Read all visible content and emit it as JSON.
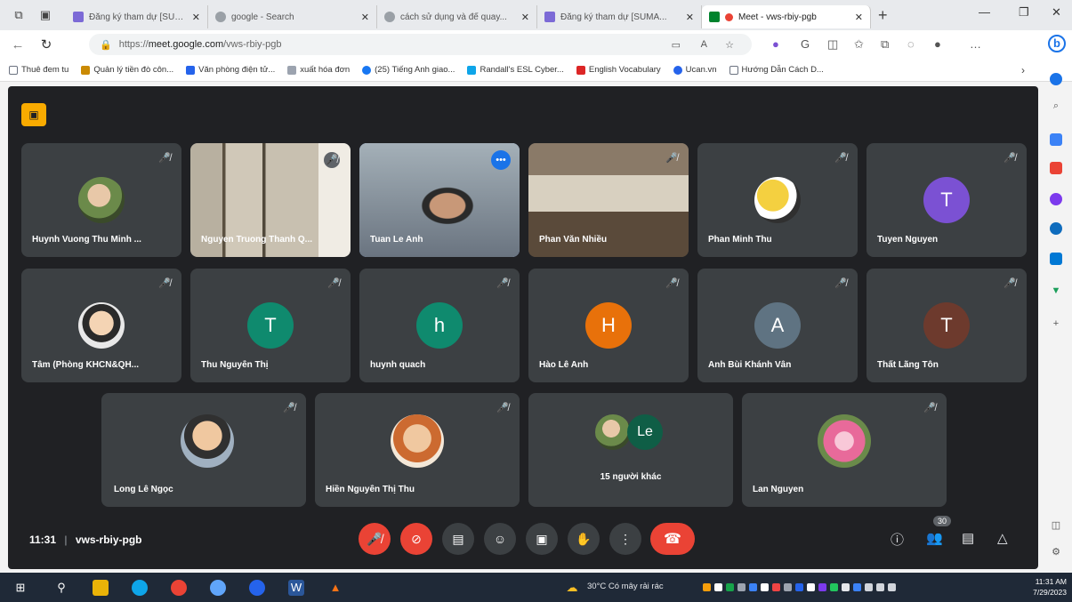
{
  "browser": {
    "tabs": [
      {
        "label": "Đăng ký tham dự [SUMA...",
        "color": "#7c6ad6"
      },
      {
        "label": "google - Search",
        "color": "#9aa0a6"
      },
      {
        "label": "cách sử dụng và để quay...",
        "color": "#9aa0a6"
      },
      {
        "label": "Đăng ký tham dự [SUMA...",
        "color": "#7c6ad6"
      },
      {
        "label": "Meet - vws-rbiy-pgb",
        "color": "#00832d"
      }
    ],
    "url_prefix": "https://",
    "url_host": "meet.google.com",
    "url_path": "/vws-rbiy-pgb",
    "bookmarks": [
      {
        "label": "Thuê đem tu",
        "color": "#6b7280"
      },
      {
        "label": "Quản lý tiền đò côn...",
        "color": "#ca8a04"
      },
      {
        "label": "Văn phòng điện tử...",
        "color": "#2563eb"
      },
      {
        "label": "xuất hóa đơn",
        "color": "#6b7280"
      },
      {
        "label": "(25) Tiếng Anh giao...",
        "color": "#1877f2"
      },
      {
        "label": "Randall's ESL Cyber...",
        "color": "#0ea5e9"
      },
      {
        "label": "English Vocabulary",
        "color": "#dc2626"
      },
      {
        "label": "Ucan.vn",
        "color": "#2563eb"
      },
      {
        "label": "Hướng Dẫn Cách D...",
        "color": "#6b7280"
      }
    ]
  },
  "meet": {
    "time": "11:31",
    "separator": "|",
    "code": "vws-rbiy-pgb",
    "participant_count": "30",
    "participants": [
      {
        "name": "Huynh Vuong Thu Minh ...",
        "avatar": "photo"
      },
      {
        "name": "Nguyen Truong Thanh Q...",
        "avatar": "video"
      },
      {
        "name": "Tuan Le Anh",
        "avatar": "video"
      },
      {
        "name": "Phan Văn Nhiều",
        "avatar": "video"
      },
      {
        "name": "Phan Minh Thu",
        "avatar": "photo"
      },
      {
        "name": "Tuyen Nguyen",
        "initial": "T",
        "color": "#7b51d3"
      },
      {
        "name": "Tâm (Phòng KHCN&QH...",
        "avatar": "photo"
      },
      {
        "name": "Thu Nguyễn Thị",
        "initial": "T",
        "color": "#0f8a6e"
      },
      {
        "name": "huynh quach",
        "initial": "h",
        "color": "#0f8a6e"
      },
      {
        "name": "Hào Lê Anh",
        "initial": "H",
        "color": "#e8710a"
      },
      {
        "name": "Anh Bùi Khánh Vân",
        "initial": "A",
        "color": "#5f7382"
      },
      {
        "name": "Thất Lãng Tôn",
        "initial": "T",
        "color": "#6d3a2d"
      },
      {
        "name": "Long Lê Ngọc",
        "avatar": "photo"
      },
      {
        "name": "Hiền Nguyễn Thị Thu",
        "avatar": "photo"
      },
      {
        "name": "15 người khác",
        "initial": "Le",
        "color": "#0f5e46"
      },
      {
        "name": "Lan Nguyen",
        "avatar": "photo"
      }
    ]
  },
  "taskbar": {
    "weather": "30°C  Có mây rải rác",
    "time": "11:31 AM",
    "date": "7/29/2023"
  }
}
